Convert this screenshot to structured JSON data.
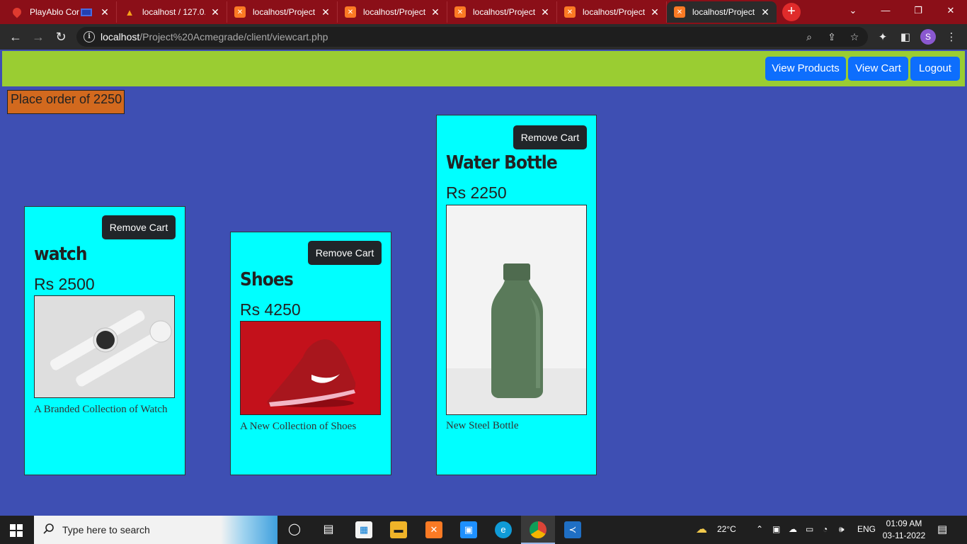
{
  "browser": {
    "tabs": [
      {
        "title": "PlayAblo Cor",
        "favicon": "pin-icon",
        "active": false
      },
      {
        "title": "localhost / 127.0.",
        "favicon": "phpmyadmin-icon",
        "active": false
      },
      {
        "title": "localhost/Project",
        "favicon": "xampp-icon",
        "active": false
      },
      {
        "title": "localhost/Project",
        "favicon": "xampp-icon",
        "active": false
      },
      {
        "title": "localhost/Project",
        "favicon": "xampp-icon",
        "active": false
      },
      {
        "title": "localhost/Project",
        "favicon": "xampp-icon",
        "active": false
      },
      {
        "title": "localhost/Project",
        "favicon": "xampp-icon",
        "active": true
      }
    ],
    "url_host": "localhost",
    "url_path": "/Project%20Acmegrade/client/viewcart.php",
    "profile_initial": "S",
    "colors": {
      "tabbar": "#8b0f18",
      "toolbar": "#2b2b2b"
    }
  },
  "nav": {
    "view_products": "View Products",
    "view_cart": "View Cart",
    "logout": "Logout",
    "bar_color": "#9acd32",
    "button_color": "#0d6efd"
  },
  "place_order": "Place order of 2250",
  "cards": [
    {
      "title": "watch",
      "price": "Rs 2500",
      "remove_label": "Remove Cart",
      "description": "A Branded Collection of Watch"
    },
    {
      "title": "Shoes",
      "price": "Rs 4250",
      "remove_label": "Remove Cart",
      "description": "A New Collection of Shoes"
    },
    {
      "title": "Water Bottle",
      "price": "Rs 2250",
      "remove_label": "Remove Cart",
      "description": "New Steel Bottle"
    }
  ],
  "page_colors": {
    "background": "#3e4fb3",
    "card": "#00ffff",
    "order_button": "#d2691e"
  },
  "taskbar": {
    "search_placeholder": "Type here to search",
    "weather": "22°C",
    "language": "ENG",
    "time": "01:09 AM",
    "date": "03-11-2022"
  }
}
